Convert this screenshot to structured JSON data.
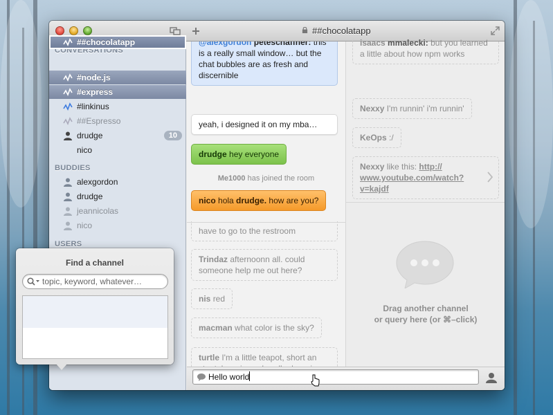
{
  "window": {
    "title": "##chocolatapp"
  },
  "sidebar": {
    "conversations_header": "CONVERSATIONS",
    "conversations": [
      {
        "label": "##chocolatapp"
      },
      {
        "label": "#node.js"
      },
      {
        "label": "#express"
      },
      {
        "label": "#linkinus"
      },
      {
        "label": "##Espresso"
      },
      {
        "label": "drudge",
        "badge": "10"
      },
      {
        "label": "nico"
      }
    ],
    "buddies_header": "BUDDIES",
    "buddies": [
      {
        "label": "alexgordon"
      },
      {
        "label": "drudge"
      },
      {
        "label": "jeannicolas"
      },
      {
        "label": "nico"
      }
    ],
    "users_header": "USERS"
  },
  "chat": {
    "messages": [
      {
        "nick": "@alexgordon",
        "nick2": "peteschaffner:",
        "text": "this is a really small window… but the chat bubbles are as fresh and discernible"
      },
      {
        "text": "yeah, i designed it on my mba…"
      },
      {
        "nick": "drudge",
        "text": "hey everyone"
      },
      {
        "nick": "Me1000",
        "text": "has joined the room"
      },
      {
        "nick": "nico",
        "text": "hola",
        "mention": "drudge.",
        "tail": "how are you?"
      },
      {
        "text": "have to go to the restroom"
      },
      {
        "nick": "Trindaz",
        "text": "afternoonn all. could someone help me out here?"
      },
      {
        "nick": "nis",
        "text": "red"
      },
      {
        "nick": "macman",
        "text": "what color is the sky?"
      },
      {
        "nick": "turtle",
        "text": "I'm a little teapot, short an stout. here is my handle, here is my spout."
      }
    ]
  },
  "chat2": {
    "messages": [
      {
        "nick": "isaacs",
        "nick2": "mmalecki:",
        "text": "but you learned a little about how npm works"
      },
      {
        "nick": "Nexxy",
        "text": "I'm runnin' i'm runnin'"
      },
      {
        "nick": "KeOps",
        "text": ":/"
      },
      {
        "nick": "Nexxy",
        "text": "like this:",
        "link": "http:// www.youtube.com/watch? v=kajdf"
      }
    ],
    "drop_line1": "Drag another channel",
    "drop_line2": "or query here (or ⌘–click)"
  },
  "input": {
    "value": "Hello world"
  },
  "popover": {
    "title": "Find a channel",
    "search_placeholder": "topic, keyword, whatever…"
  }
}
